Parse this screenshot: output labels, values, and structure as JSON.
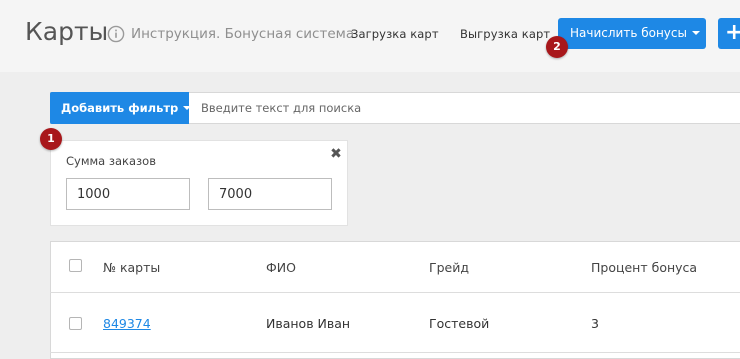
{
  "header": {
    "title": "Карты",
    "instruction_link": "Инструкция. Бонусная система",
    "upload_link": "Загрузка карт",
    "download_link": "Выгрузка карт",
    "accrue_button": "Начислить бонусы",
    "add_button": "+"
  },
  "markers": {
    "one": "1",
    "two": "2"
  },
  "filter_bar": {
    "add_filter_button": "Добавить фильтр",
    "search_placeholder": "Введите текст для поиска"
  },
  "filter_popover": {
    "label": "Сумма заказов",
    "from_value": "1000",
    "to_value": "7000",
    "close_glyph": "✖"
  },
  "table": {
    "columns": [
      "№ карты",
      "ФИО",
      "Грейд",
      "Процент бонуса"
    ],
    "rows": [
      {
        "card_number": "849374",
        "name": "Иванов Иван",
        "grade": "Гостевой",
        "bonus_percent": "3"
      }
    ]
  },
  "colors": {
    "accent": "#1e88e5",
    "marker": "#a8171b",
    "page_bg": "#eeeeee"
  },
  "icons": {
    "info": "info-icon",
    "close": "close-icon",
    "caret": "caret-down-icon"
  }
}
